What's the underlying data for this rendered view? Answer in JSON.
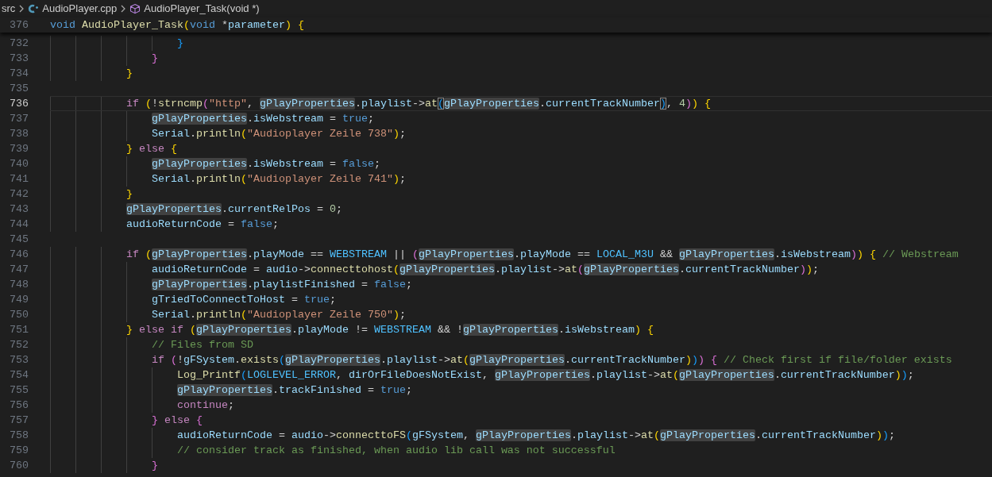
{
  "breadcrumbs": [
    {
      "text": "src",
      "kind": "folder"
    },
    {
      "text": "AudioPlayer.cpp",
      "kind": "file"
    },
    {
      "text": "AudioPlayer_Task(void *)",
      "kind": "symbol"
    }
  ],
  "sticky_line": {
    "number": "376",
    "tokens": [
      {
        "text": "void ",
        "kind": "kw"
      },
      {
        "text": "AudioPlayer_Task",
        "kind": "fn"
      },
      {
        "text": "(",
        "kind": "b1"
      },
      {
        "text": "void",
        "kind": "kw"
      },
      {
        "text": " *",
        "kind": "op"
      },
      {
        "text": "parameter",
        "kind": "var"
      },
      {
        "text": ") ",
        "kind": "b1"
      },
      {
        "text": "{",
        "kind": "b1"
      }
    ]
  },
  "lines": [
    {
      "number": "732",
      "current": false,
      "tokens": [
        {
          "text": "                    }",
          "kind": "b3"
        }
      ]
    },
    {
      "number": "733",
      "current": false,
      "tokens": [
        {
          "text": "                }",
          "kind": "b2"
        }
      ]
    },
    {
      "number": "734",
      "current": false,
      "tokens": [
        {
          "text": "            }",
          "kind": "b1"
        }
      ]
    },
    {
      "number": "735",
      "current": false
    },
    {
      "number": "736",
      "current": true,
      "tokens": [
        {
          "text": "            if ",
          "kind": "ctl"
        },
        {
          "text": "(",
          "kind": "b1"
        },
        {
          "text": "!",
          "kind": "op"
        },
        {
          "text": "strncmp",
          "kind": "fn"
        },
        {
          "text": "(",
          "kind": "b2"
        },
        {
          "text": "\"http\"",
          "kind": "str"
        },
        {
          "text": ", ",
          "kind": "op"
        },
        {
          "text": "gPlayProperties",
          "kind": "hl"
        },
        {
          "text": ".",
          "kind": "op"
        },
        {
          "text": "playlist",
          "kind": "var"
        },
        {
          "text": "->",
          "kind": "op"
        },
        {
          "text": "at",
          "kind": "fn"
        },
        {
          "text": "(",
          "kind": "b3m"
        },
        {
          "text": "gPlayProperties",
          "kind": "hl"
        },
        {
          "text": ".",
          "kind": "op"
        },
        {
          "text": "currentTrackNumber",
          "kind": "var"
        },
        {
          "text": ")",
          "kind": "b3m"
        },
        {
          "text": ", ",
          "kind": "op"
        },
        {
          "text": "4",
          "kind": "num"
        },
        {
          "text": ")",
          "kind": "b2"
        },
        {
          "text": ") ",
          "kind": "b1"
        },
        {
          "text": "{",
          "kind": "b1"
        }
      ]
    },
    {
      "number": "737",
      "current": false,
      "tokens": [
        {
          "text": "                gPlayProperties",
          "kind": "hl"
        },
        {
          "text": ".",
          "kind": "op"
        },
        {
          "text": "isWebstream",
          "kind": "var"
        },
        {
          "text": " = ",
          "kind": "op"
        },
        {
          "text": "true",
          "kind": "kw"
        },
        {
          "text": ";",
          "kind": "op"
        }
      ]
    },
    {
      "number": "738",
      "current": false,
      "tokens": [
        {
          "text": "                Serial",
          "kind": "var"
        },
        {
          "text": ".",
          "kind": "op"
        },
        {
          "text": "println",
          "kind": "fn"
        },
        {
          "text": "(",
          "kind": "b1"
        },
        {
          "text": "\"Audioplayer Zeile 738\"",
          "kind": "str"
        },
        {
          "text": ")",
          "kind": "b1"
        },
        {
          "text": ";",
          "kind": "op"
        }
      ]
    },
    {
      "number": "739",
      "current": false,
      "tokens": [
        {
          "text": "            } ",
          "kind": "b1"
        },
        {
          "text": "else ",
          "kind": "ctl"
        },
        {
          "text": "{",
          "kind": "b1"
        }
      ]
    },
    {
      "number": "740",
      "current": false,
      "tokens": [
        {
          "text": "                gPlayProperties",
          "kind": "hl"
        },
        {
          "text": ".",
          "kind": "op"
        },
        {
          "text": "isWebstream",
          "kind": "var"
        },
        {
          "text": " = ",
          "kind": "op"
        },
        {
          "text": "false",
          "kind": "kw"
        },
        {
          "text": ";",
          "kind": "op"
        }
      ]
    },
    {
      "number": "741",
      "current": false,
      "tokens": [
        {
          "text": "                Serial",
          "kind": "var"
        },
        {
          "text": ".",
          "kind": "op"
        },
        {
          "text": "println",
          "kind": "fn"
        },
        {
          "text": "(",
          "kind": "b1"
        },
        {
          "text": "\"Audioplayer Zeile 741\"",
          "kind": "str"
        },
        {
          "text": ")",
          "kind": "b1"
        },
        {
          "text": ";",
          "kind": "op"
        }
      ]
    },
    {
      "number": "742",
      "current": false,
      "tokens": [
        {
          "text": "            }",
          "kind": "b1"
        }
      ]
    },
    {
      "number": "743",
      "current": false,
      "tokens": [
        {
          "text": "            gPlayProperties",
          "kind": "hl"
        },
        {
          "text": ".",
          "kind": "op"
        },
        {
          "text": "currentRelPos",
          "kind": "var"
        },
        {
          "text": " = ",
          "kind": "op"
        },
        {
          "text": "0",
          "kind": "num"
        },
        {
          "text": ";",
          "kind": "op"
        }
      ]
    },
    {
      "number": "744",
      "current": false,
      "tokens": [
        {
          "text": "            audioReturnCode",
          "kind": "var"
        },
        {
          "text": " = ",
          "kind": "op"
        },
        {
          "text": "false",
          "kind": "kw"
        },
        {
          "text": ";",
          "kind": "op"
        }
      ]
    },
    {
      "number": "745",
      "current": false
    },
    {
      "number": "746",
      "current": false,
      "tokens": [
        {
          "text": "            if ",
          "kind": "ctl"
        },
        {
          "text": "(",
          "kind": "b1"
        },
        {
          "text": "gPlayProperties",
          "kind": "hl"
        },
        {
          "text": ".",
          "kind": "op"
        },
        {
          "text": "playMode",
          "kind": "var"
        },
        {
          "text": " == ",
          "kind": "op"
        },
        {
          "text": "WEBSTREAM",
          "kind": "const"
        },
        {
          "text": " || ",
          "kind": "op"
        },
        {
          "text": "(",
          "kind": "b2"
        },
        {
          "text": "gPlayProperties",
          "kind": "hl"
        },
        {
          "text": ".",
          "kind": "op"
        },
        {
          "text": "playMode",
          "kind": "var"
        },
        {
          "text": " == ",
          "kind": "op"
        },
        {
          "text": "LOCAL_M3U",
          "kind": "const"
        },
        {
          "text": " && ",
          "kind": "op"
        },
        {
          "text": "gPlayProperties",
          "kind": "hl"
        },
        {
          "text": ".",
          "kind": "op"
        },
        {
          "text": "isWebstream",
          "kind": "var"
        },
        {
          "text": ")",
          "kind": "b2"
        },
        {
          "text": ") ",
          "kind": "b1"
        },
        {
          "text": "{ ",
          "kind": "b1"
        },
        {
          "text": "// Webstream",
          "kind": "com"
        }
      ]
    },
    {
      "number": "747",
      "current": false,
      "tokens": [
        {
          "text": "                audioReturnCode",
          "kind": "var"
        },
        {
          "text": " = ",
          "kind": "op"
        },
        {
          "text": "audio",
          "kind": "var"
        },
        {
          "text": "->",
          "kind": "op"
        },
        {
          "text": "connecttohost",
          "kind": "fn"
        },
        {
          "text": "(",
          "kind": "b1"
        },
        {
          "text": "gPlayProperties",
          "kind": "hl"
        },
        {
          "text": ".",
          "kind": "op"
        },
        {
          "text": "playlist",
          "kind": "var"
        },
        {
          "text": "->",
          "kind": "op"
        },
        {
          "text": "at",
          "kind": "fn"
        },
        {
          "text": "(",
          "kind": "b2"
        },
        {
          "text": "gPlayProperties",
          "kind": "hl"
        },
        {
          "text": ".",
          "kind": "op"
        },
        {
          "text": "currentTrackNumber",
          "kind": "var"
        },
        {
          "text": ")",
          "kind": "b2"
        },
        {
          "text": ")",
          "kind": "b1"
        },
        {
          "text": ";",
          "kind": "op"
        }
      ]
    },
    {
      "number": "748",
      "current": false,
      "tokens": [
        {
          "text": "                gPlayProperties",
          "kind": "hl"
        },
        {
          "text": ".",
          "kind": "op"
        },
        {
          "text": "playlistFinished",
          "kind": "var"
        },
        {
          "text": " = ",
          "kind": "op"
        },
        {
          "text": "false",
          "kind": "kw"
        },
        {
          "text": ";",
          "kind": "op"
        }
      ]
    },
    {
      "number": "749",
      "current": false,
      "tokens": [
        {
          "text": "                gTriedToConnectToHost",
          "kind": "var"
        },
        {
          "text": " = ",
          "kind": "op"
        },
        {
          "text": "true",
          "kind": "kw"
        },
        {
          "text": ";",
          "kind": "op"
        }
      ]
    },
    {
      "number": "750",
      "current": false,
      "tokens": [
        {
          "text": "                Serial",
          "kind": "var"
        },
        {
          "text": ".",
          "kind": "op"
        },
        {
          "text": "println",
          "kind": "fn"
        },
        {
          "text": "(",
          "kind": "b1"
        },
        {
          "text": "\"Audioplayer Zeile 750\"",
          "kind": "str"
        },
        {
          "text": ")",
          "kind": "b1"
        },
        {
          "text": ";",
          "kind": "op"
        }
      ]
    },
    {
      "number": "751",
      "current": false,
      "tokens": [
        {
          "text": "            } ",
          "kind": "b1"
        },
        {
          "text": "else if ",
          "kind": "ctl"
        },
        {
          "text": "(",
          "kind": "b1"
        },
        {
          "text": "gPlayProperties",
          "kind": "hl"
        },
        {
          "text": ".",
          "kind": "op"
        },
        {
          "text": "playMode",
          "kind": "var"
        },
        {
          "text": " != ",
          "kind": "op"
        },
        {
          "text": "WEBSTREAM",
          "kind": "const"
        },
        {
          "text": " && !",
          "kind": "op"
        },
        {
          "text": "gPlayProperties",
          "kind": "hl"
        },
        {
          "text": ".",
          "kind": "op"
        },
        {
          "text": "isWebstream",
          "kind": "var"
        },
        {
          "text": ") ",
          "kind": "b1"
        },
        {
          "text": "{",
          "kind": "b1"
        }
      ]
    },
    {
      "number": "752",
      "current": false,
      "tokens": [
        {
          "text": "                // Files from SD",
          "kind": "com"
        }
      ]
    },
    {
      "number": "753",
      "current": false,
      "tokens": [
        {
          "text": "                if ",
          "kind": "ctl"
        },
        {
          "text": "(",
          "kind": "b2"
        },
        {
          "text": "!",
          "kind": "op"
        },
        {
          "text": "gFSystem",
          "kind": "var"
        },
        {
          "text": ".",
          "kind": "op"
        },
        {
          "text": "exists",
          "kind": "fn"
        },
        {
          "text": "(",
          "kind": "b3"
        },
        {
          "text": "gPlayProperties",
          "kind": "hl"
        },
        {
          "text": ".",
          "kind": "op"
        },
        {
          "text": "playlist",
          "kind": "var"
        },
        {
          "text": "->",
          "kind": "op"
        },
        {
          "text": "at",
          "kind": "fn"
        },
        {
          "text": "(",
          "kind": "b1"
        },
        {
          "text": "gPlayProperties",
          "kind": "hl"
        },
        {
          "text": ".",
          "kind": "op"
        },
        {
          "text": "currentTrackNumber",
          "kind": "var"
        },
        {
          "text": ")",
          "kind": "b1"
        },
        {
          "text": ")",
          "kind": "b3"
        },
        {
          "text": ") ",
          "kind": "b2"
        },
        {
          "text": "{ ",
          "kind": "b2"
        },
        {
          "text": "// Check first if file/folder exists",
          "kind": "com"
        }
      ]
    },
    {
      "number": "754",
      "current": false,
      "tokens": [
        {
          "text": "                    Log_Printf",
          "kind": "fn"
        },
        {
          "text": "(",
          "kind": "b3"
        },
        {
          "text": "LOGLEVEL_ERROR",
          "kind": "const"
        },
        {
          "text": ", ",
          "kind": "op"
        },
        {
          "text": "dirOrFileDoesNotExist",
          "kind": "var"
        },
        {
          "text": ", ",
          "kind": "op"
        },
        {
          "text": "gPlayProperties",
          "kind": "hl"
        },
        {
          "text": ".",
          "kind": "op"
        },
        {
          "text": "playlist",
          "kind": "var"
        },
        {
          "text": "->",
          "kind": "op"
        },
        {
          "text": "at",
          "kind": "fn"
        },
        {
          "text": "(",
          "kind": "b1"
        },
        {
          "text": "gPlayProperties",
          "kind": "hl"
        },
        {
          "text": ".",
          "kind": "op"
        },
        {
          "text": "currentTrackNumber",
          "kind": "var"
        },
        {
          "text": ")",
          "kind": "b1"
        },
        {
          "text": ")",
          "kind": "b3"
        },
        {
          "text": ";",
          "kind": "op"
        }
      ]
    },
    {
      "number": "755",
      "current": false,
      "tokens": [
        {
          "text": "                    gPlayProperties",
          "kind": "hl"
        },
        {
          "text": ".",
          "kind": "op"
        },
        {
          "text": "trackFinished",
          "kind": "var"
        },
        {
          "text": " = ",
          "kind": "op"
        },
        {
          "text": "true",
          "kind": "kw"
        },
        {
          "text": ";",
          "kind": "op"
        }
      ]
    },
    {
      "number": "756",
      "current": false,
      "tokens": [
        {
          "text": "                    continue",
          "kind": "ctl"
        },
        {
          "text": ";",
          "kind": "op"
        }
      ]
    },
    {
      "number": "757",
      "current": false,
      "tokens": [
        {
          "text": "                } ",
          "kind": "b2"
        },
        {
          "text": "else ",
          "kind": "ctl"
        },
        {
          "text": "{",
          "kind": "b2"
        }
      ]
    },
    {
      "number": "758",
      "current": false,
      "tokens": [
        {
          "text": "                    audioReturnCode",
          "kind": "var"
        },
        {
          "text": " = ",
          "kind": "op"
        },
        {
          "text": "audio",
          "kind": "var"
        },
        {
          "text": "->",
          "kind": "op"
        },
        {
          "text": "connecttoFS",
          "kind": "fn"
        },
        {
          "text": "(",
          "kind": "b3"
        },
        {
          "text": "gFSystem",
          "kind": "var"
        },
        {
          "text": ", ",
          "kind": "op"
        },
        {
          "text": "gPlayProperties",
          "kind": "hl"
        },
        {
          "text": ".",
          "kind": "op"
        },
        {
          "text": "playlist",
          "kind": "var"
        },
        {
          "text": "->",
          "kind": "op"
        },
        {
          "text": "at",
          "kind": "fn"
        },
        {
          "text": "(",
          "kind": "b1"
        },
        {
          "text": "gPlayProperties",
          "kind": "hl"
        },
        {
          "text": ".",
          "kind": "op"
        },
        {
          "text": "currentTrackNumber",
          "kind": "var"
        },
        {
          "text": ")",
          "kind": "b1"
        },
        {
          "text": ")",
          "kind": "b3"
        },
        {
          "text": ";",
          "kind": "op"
        }
      ]
    },
    {
      "number": "759",
      "current": false,
      "tokens": [
        {
          "text": "                    // consider track as finished, when audio lib call was not successful",
          "kind": "com"
        }
      ]
    },
    {
      "number": "760",
      "current": false,
      "tokens": [
        {
          "text": "                }",
          "kind": "b2"
        }
      ]
    }
  ]
}
